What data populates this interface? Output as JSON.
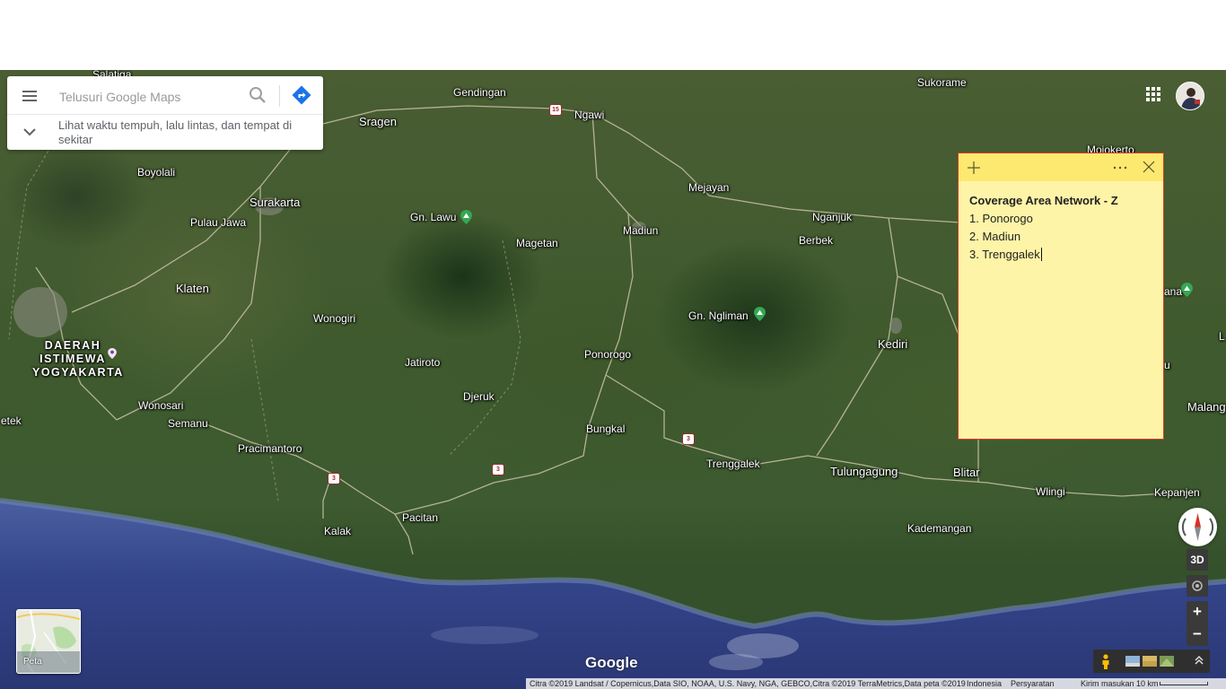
{
  "search": {
    "placeholder": "Telusuri Google Maps",
    "expand_text": "Lihat waktu tempuh, lalu lintas, dan tempat di sekitar"
  },
  "places": {
    "salatiga": "Salatiga",
    "gendingan": "Gendingan",
    "sukorame": "Sukorame",
    "sragen": "Sragen",
    "ngawi": "Ngawi",
    "mojokerto": "Mojokerto",
    "boyolali": "Boyolali",
    "surakarta": "Surakarta",
    "mejayan": "Mejayan",
    "gn_lawu": "Gn. Lawu",
    "nganjuk": "Nganjuk",
    "pulau_jawa": "Pulau Jawa",
    "magetan": "Magetan",
    "madiun": "Madiun",
    "berbek": "Berbek",
    "klaten": "Klaten",
    "gn_ngliman": "Gn. Ngliman",
    "wonogiri": "Wonogiri",
    "kediri": "Kediri",
    "diy_1": "DAERAH",
    "diy_2": "ISTIMEWA",
    "diy_3": "YOGYAKARTA",
    "ponorogo": "Ponorogo",
    "jatiroto": "Jatiroto",
    "djeruk": "Djeruk",
    "wonosari": "Wonosari",
    "etek": "etek",
    "semanu": "Semanu",
    "bungkal": "Bungkal",
    "pracimantoro": "Pracimantoro",
    "trenggalek": "Trenggalek",
    "tulungagung": "Tulungagung",
    "blitar": "Blitar",
    "wlingi": "Wlingi",
    "kepanjen": "Kepanjen",
    "pacitan": "Pacitan",
    "kalak": "Kalak",
    "kademangan": "Kademangan",
    "malang": "Malang",
    "ana": "ana",
    "u_partial": "u",
    "l_partial": "L"
  },
  "road_shields": [
    "15",
    "3",
    "3",
    "3"
  ],
  "sticky_note": {
    "title": "Coverage Area Network - Z",
    "lines": [
      "1. Ponorogo",
      "2. Madiun",
      "3. Trenggalek"
    ],
    "header_color": "#fde970",
    "body_color": "#fef4a7"
  },
  "controls": {
    "label_3d": "3D",
    "zoom_in": "+",
    "zoom_out": "−"
  },
  "layer": {
    "label": "Peta"
  },
  "logo": "Google",
  "footer": {
    "attribution": "Citra ©2019 Landsat / Copernicus,Data SIO, NOAA, U.S. Navy, NGA, GEBCO,Citra ©2019 TerraMetrics,Data peta ©2019",
    "country": "Indonesia",
    "terms": "Persyaratan",
    "feedback": "Kirim masukan",
    "scale": "10 km"
  },
  "icons": [
    "menu-icon",
    "search-icon",
    "directions-icon",
    "chevron-down-icon",
    "apps-grid-icon",
    "account-avatar",
    "plus-icon",
    "more-icon",
    "close-icon",
    "compass-icon",
    "location-icon",
    "pegman-icon",
    "expand-icon"
  ]
}
